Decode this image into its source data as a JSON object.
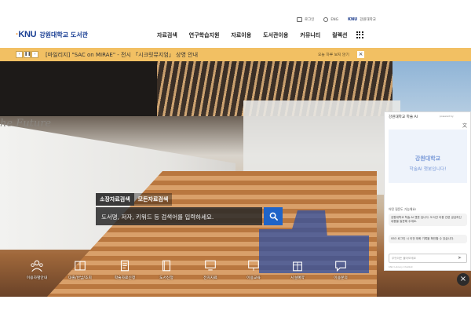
{
  "utility": {
    "items": [
      "로그인",
      "ENG",
      "강원대학교"
    ],
    "knu_mini": "KNU"
  },
  "header": {
    "logo_knu": "KNU",
    "logo_name": "강원대학교 도서관",
    "nav": [
      "자료검색",
      "연구학습지원",
      "자료이용",
      "도서관이용",
      "커뮤니티",
      "컬렉션"
    ]
  },
  "notice": {
    "text": "[마일리지] \"SAC on MIRAE\" - 전시 「시크릿뮤지엄」 상영 안내",
    "check_label": "오늘 하루 보지 않기",
    "prev_label": "‹",
    "pause_label": "❚❚",
    "next_label": "›",
    "close_label": "×"
  },
  "hero": {
    "wall_text": "he Future"
  },
  "search": {
    "tabs": [
      "소장자료검색",
      "모든자료검색"
    ],
    "placeholder": "도서명, 저자, 키워드 등 검색어를 입력하세요."
  },
  "quick_menu": [
    "이용자별안내",
    "대출/반납/조회",
    "학술자료신청",
    "도서신청",
    "전자자료",
    "이용교육",
    "시설예약",
    "이용문의"
  ],
  "chat": {
    "title": "강원대학교 학술 AI",
    "powered": "powered by",
    "welcome_univ": "강원대학교",
    "welcome_msg": "학술AI 챗봇입니다!",
    "greeting": "어떤 질문도 가능해요!",
    "bubbles": [
      "강원대학교 학술 AI 챗봇 입니다. 도서관 이용 관련 궁금하신 내용을 질문해 주세요.",
      "SSO 로그인 시 이전 대화 기록을 확인할 수 있습니다."
    ],
    "input_placeholder": "무엇이든 물어보세요",
    "footer": "KNU Library Chatbot"
  },
  "colors": {
    "brand_blue": "#1a3f94",
    "notice_bg": "#f2c063",
    "search_btn": "#1f64c8"
  }
}
